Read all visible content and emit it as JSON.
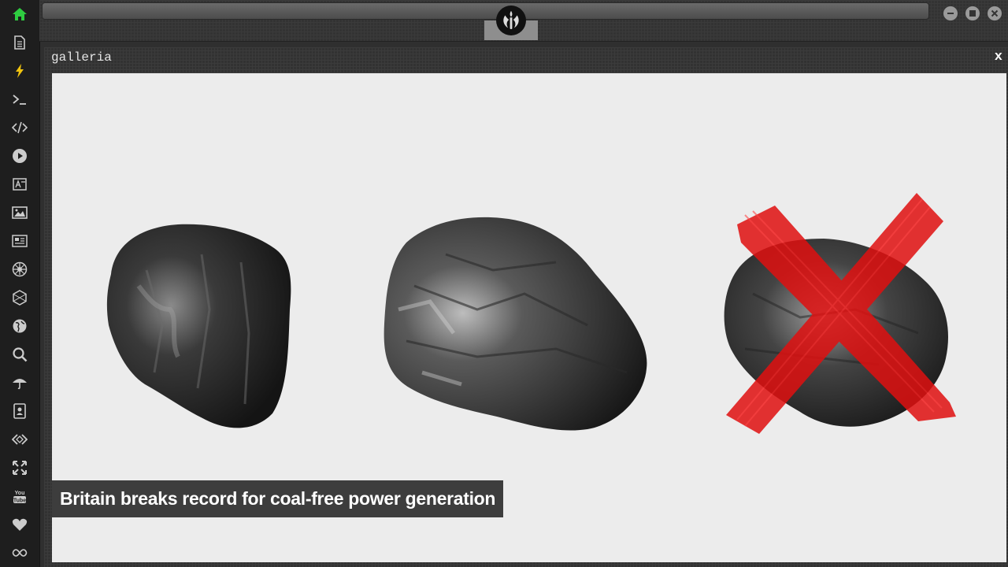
{
  "sidebar": {
    "icons": [
      {
        "name": "home-icon"
      },
      {
        "name": "document-icon"
      },
      {
        "name": "lightning-icon"
      },
      {
        "name": "terminal-icon"
      },
      {
        "name": "code-icon"
      },
      {
        "name": "play-icon"
      },
      {
        "name": "translate-icon"
      },
      {
        "name": "image-icon"
      },
      {
        "name": "news-icon"
      },
      {
        "name": "empire-icon"
      },
      {
        "name": "hexagon-icon"
      },
      {
        "name": "globe-icon"
      },
      {
        "name": "search-icon"
      },
      {
        "name": "umbrella-icon"
      },
      {
        "name": "contacts-icon"
      },
      {
        "name": "embed-icon"
      },
      {
        "name": "expand-icon"
      },
      {
        "name": "youtube-icon"
      },
      {
        "name": "heart-icon"
      },
      {
        "name": "infinity-icon"
      }
    ]
  },
  "window": {
    "title": "galleria",
    "close_label": "x"
  },
  "gallery": {
    "caption": "Britain breaks record for coal-free power generation"
  },
  "colors": {
    "accent_green": "#2ecc40",
    "accent_yellow": "#f1c40f",
    "cross_red": "#e01010"
  }
}
